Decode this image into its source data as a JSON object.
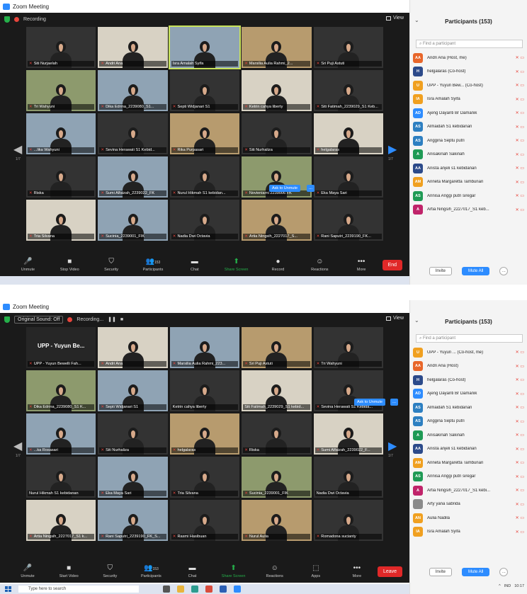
{
  "screens": [
    {
      "title": "Zoom Meeting",
      "top_status": [
        "Recording"
      ],
      "view_label": "View",
      "tiles": [
        {
          "name": "Siti Nurjaelah",
          "muted": true
        },
        {
          "name": "Andri Ana",
          "muted": true
        },
        {
          "name": "Isra Amalah Syifa",
          "muted": false
        },
        {
          "name": "Marsilia Aulia Rahmi_2...",
          "muted": true
        },
        {
          "name": "Sri Puji Astuti",
          "muted": true
        },
        {
          "name": "Tri Wahyuni",
          "muted": true
        },
        {
          "name": "Dika Edrina_2239080_S1...",
          "muted": true
        },
        {
          "name": "Septi Widjanari S1",
          "muted": true
        },
        {
          "name": "Ketrin cahya liberty",
          "muted": true
        },
        {
          "name": "Siti Fatimah_2239029_S1 Keb...",
          "muted": true
        },
        {
          "name": "...lika Wahyuni",
          "muted": true
        },
        {
          "name": "Sevina Herawati S1 Kebid...",
          "muted": true
        },
        {
          "name": "Rika Purpasari",
          "muted": true
        },
        {
          "name": "Siti Nurhaliza",
          "muted": true
        },
        {
          "name": "helgalaras",
          "muted": true
        },
        {
          "name": "Riska",
          "muted": true
        },
        {
          "name": "Sumi Alfaizah_2239022_FK",
          "muted": true
        },
        {
          "name": "Nurul Hikmah S1 kebidan...",
          "muted": true
        },
        {
          "name": "Novieniarni 2239006 FK",
          "muted": true
        },
        {
          "name": "Eka Maya Sari",
          "muted": true
        },
        {
          "name": "Tria Silvana",
          "muted": true
        },
        {
          "name": "Sucinia_2239001_FIK",
          "muted": true
        },
        {
          "name": "Nadia Dwi Octavia",
          "muted": true
        },
        {
          "name": "Artia Ningsih_2227017_S...",
          "muted": true
        },
        {
          "name": "Rani Saputri_2239190_FK...",
          "muted": true
        }
      ],
      "ask_unmute": "Ask to Unmute",
      "page_indicator": "1/7",
      "toolbar": [
        {
          "icon": "microphone-icon",
          "label": "Unmute"
        },
        {
          "icon": "video-icon",
          "label": "Stop Video"
        },
        {
          "icon": "shield-icon",
          "label": "Security"
        },
        {
          "icon": "participants-icon",
          "label": "Participants",
          "badge": "153"
        },
        {
          "icon": "chat-icon",
          "label": "Chat"
        },
        {
          "icon": "share-screen-icon",
          "label": "Share Screen"
        },
        {
          "icon": "record-icon",
          "label": "Record"
        },
        {
          "icon": "reactions-icon",
          "label": "Reactions"
        },
        {
          "icon": "more-icon",
          "label": "More"
        }
      ],
      "end_label": "End",
      "participants_panel": {
        "title": "Participants (153)",
        "search_placeholder": "Find a participant",
        "people": [
          {
            "initials": "AA",
            "name": "Andri Ana (Host, me)",
            "color": "#e8662a"
          },
          {
            "initials": "H",
            "name": "helgalaras (Co-host)",
            "color": "#2c4a8a"
          },
          {
            "initials": "U",
            "name": "UPP - Yuyun Bew... (Co-host)",
            "color": "#f0a020"
          },
          {
            "initials": "IA",
            "name": "Isra Amalah Syifa",
            "color": "#f0a020"
          },
          {
            "initials": "AD",
            "name": "Ajeng Dayanti Br Damanik",
            "color": "#2d8cff"
          },
          {
            "initials": "AS",
            "name": "Almaidah S1 kebidanan",
            "color": "#2d7fc1"
          },
          {
            "initials": "AS",
            "name": "Anggina Septu putri",
            "color": "#2d7fc1"
          },
          {
            "initials": "A",
            "name": "Anisakinah Sakinah",
            "color": "#1f9a55"
          },
          {
            "initials": "AA",
            "name": "Anista anjeli s1 kebidanan",
            "color": "#2c4a8a"
          },
          {
            "initials": "AM",
            "name": "Anneta Margaretta Tambunan",
            "color": "#f0a020"
          },
          {
            "initials": "AS",
            "name": "Annisa Anggi putri siregar",
            "color": "#1f9a55"
          },
          {
            "initials": "A",
            "name": "Artia Ningsih_2227017_S1 keb...",
            "color": "#c0246a"
          }
        ],
        "invite_label": "Invite",
        "mute_all_label": "Mute All"
      }
    },
    {
      "title": "Zoom Meeting",
      "top_status": [
        "Original Sound: Off",
        "Recording..."
      ],
      "view_label": "View",
      "tiles": [
        {
          "name": "UPP - Yuyun Bewelli Fah...",
          "muted": true,
          "big_label": "UPP - Yuyun Be..."
        },
        {
          "name": "Andri Ana",
          "muted": true
        },
        {
          "name": "Marsilia Aulia Rahmi_223...",
          "muted": true
        },
        {
          "name": "Sri Puji Astuti",
          "muted": true
        },
        {
          "name": "Tri Wahyuni",
          "muted": true
        },
        {
          "name": "Dika Edrina_2239080_S1 K...",
          "muted": true
        },
        {
          "name": "Septi Widjanari S1",
          "muted": true
        },
        {
          "name": "Ketrin cahya liberty",
          "muted": false
        },
        {
          "name": "Siti Fatimah_2239029_S1 kebid...",
          "muted": false
        },
        {
          "name": "Sevina Herawati S1 Kebida...",
          "muted": true
        },
        {
          "name": "...ka Rosasari",
          "muted": true
        },
        {
          "name": "Siti Nurhaliza",
          "muted": true
        },
        {
          "name": "helgalaras",
          "muted": true
        },
        {
          "name": "Riska",
          "muted": true
        },
        {
          "name": "Sumi Alfaizah_2239022_F...",
          "muted": true
        },
        {
          "name": "Nurul Hikmah S1 kebidanan",
          "muted": false
        },
        {
          "name": "Eka Maya Sari",
          "muted": true
        },
        {
          "name": "Tria Silvana",
          "muted": true
        },
        {
          "name": "Sucinia_2239001_FIK",
          "muted": true
        },
        {
          "name": "Nadia Dwi Octavia",
          "muted": false
        },
        {
          "name": "Artia Ningsih_2227017_S1 k...",
          "muted": true
        },
        {
          "name": "Rani Saputri_2239190_FK_S...",
          "muted": true
        },
        {
          "name": "Rasmi Hasibuan",
          "muted": true
        },
        {
          "name": "Nurul Aulia",
          "muted": true
        },
        {
          "name": "Romadona sucianty",
          "muted": true
        }
      ],
      "ask_unmute": "Ask to Unmute",
      "page_indicator": "1/7",
      "toolbar": [
        {
          "icon": "microphone-icon",
          "label": "Unmute"
        },
        {
          "icon": "video-icon",
          "label": "Start Video"
        },
        {
          "icon": "shield-icon",
          "label": "Security"
        },
        {
          "icon": "participants-icon",
          "label": "Participants",
          "badge": "153"
        },
        {
          "icon": "chat-icon",
          "label": "Chat"
        },
        {
          "icon": "share-screen-icon",
          "label": "Share Screen"
        },
        {
          "icon": "reactions-icon",
          "label": "Reactions"
        },
        {
          "icon": "apps-icon",
          "label": "Apps"
        },
        {
          "icon": "more-icon",
          "label": "More"
        }
      ],
      "end_label": "Leave",
      "participants_panel": {
        "title": "Participants (153)",
        "search_placeholder": "Find a participant",
        "people": [
          {
            "initials": "U",
            "name": "UPP - Yuyun ... (Co-host, me)",
            "color": "#f0a020"
          },
          {
            "initials": "AA",
            "name": "Andri Ana (Host)",
            "color": "#e8662a"
          },
          {
            "initials": "H",
            "name": "helgalaras (Co-host)",
            "color": "#2c4a8a"
          },
          {
            "initials": "AD",
            "name": "Ajeng Dayanti Br Damanik",
            "color": "#2d8cff"
          },
          {
            "initials": "AS",
            "name": "Almaidah S1 kebidanan",
            "color": "#2d7fc1"
          },
          {
            "initials": "AS",
            "name": "Anggina Septu putri",
            "color": "#2d7fc1"
          },
          {
            "initials": "A",
            "name": "Anisakinah Sakinah",
            "color": "#1f9a55"
          },
          {
            "initials": "AA",
            "name": "Anista anjeli s1 kebidanan",
            "color": "#2c4a8a"
          },
          {
            "initials": "AM",
            "name": "Anneta Margaretta Tambunan",
            "color": "#f0a020"
          },
          {
            "initials": "AS",
            "name": "Annisa Anggi putri siregar",
            "color": "#1f9a55"
          },
          {
            "initials": "A",
            "name": "Artia Ningsih_2227017_S1 kebi...",
            "color": "#c0246a"
          },
          {
            "initials": "",
            "name": "Arty yana sabrida",
            "color": "#8a8a8a"
          },
          {
            "initials": "AN",
            "name": "Aulia Nadila",
            "color": "#f0a020"
          },
          {
            "initials": "IA",
            "name": "Isra Amalah Syifa",
            "color": "#f0a020"
          }
        ],
        "invite_label": "Invite",
        "mute_all_label": "Mute All"
      },
      "taskbar": {
        "search_placeholder": "Type here to search",
        "language": "IND",
        "time": "10:17"
      }
    }
  ]
}
